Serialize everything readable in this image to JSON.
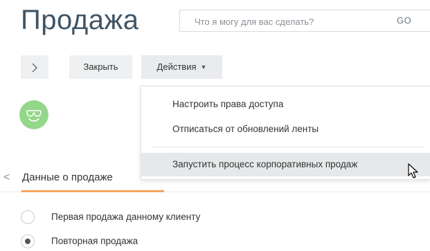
{
  "header": {
    "title": "Продажа",
    "search": {
      "placeholder": "Что я могу для вас сделать?",
      "value": "",
      "go_label": "GO"
    }
  },
  "toolbar": {
    "toggle_icon": "chevron-right-icon",
    "close_label": "Закрыть",
    "actions_label": "Действия",
    "actions_caret": "▼"
  },
  "avatar": {
    "icon": "smiley-sunglasses-icon",
    "color": "#93d788"
  },
  "actions_menu": {
    "items": [
      {
        "label": "Настроить права доступа"
      },
      {
        "label": "Отписаться от обновлений ленты"
      },
      {
        "label": "Запустить процесс корпоративных продаж",
        "hovered": true
      }
    ]
  },
  "tabs": {
    "prev_icon": "chevron-left-icon",
    "prev_glyph": "<",
    "active_label": "Данные о продаже",
    "accent": "#f5a55a"
  },
  "sale_type": {
    "options": [
      {
        "label": "Первая продажа данному клиенту",
        "checked": false
      },
      {
        "label": "Повторная продажа",
        "checked": true
      }
    ]
  }
}
